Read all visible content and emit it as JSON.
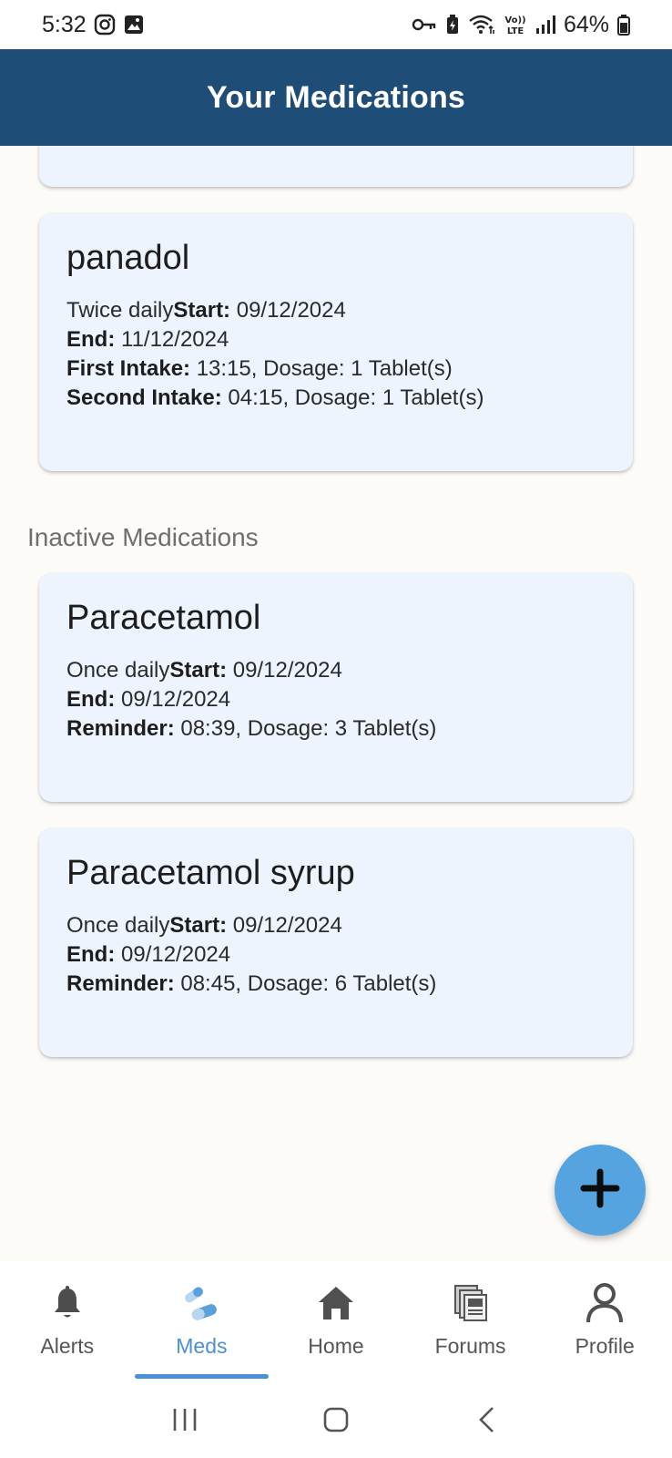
{
  "status_bar": {
    "time": "5:32",
    "battery": "64%",
    "left_icons": [
      "instagram-icon",
      "gallery-icon"
    ],
    "right_icons": [
      "vpn-key-icon",
      "battery-saver-icon",
      "wifi-icon",
      "volte-icon",
      "signal-icon",
      "battery-icon"
    ]
  },
  "app_bar": {
    "title": "Your Medications"
  },
  "active_medications": [
    {
      "name": "panadol",
      "frequency": "Twice daily",
      "start_label": "Start:",
      "start": " 09/12/2024",
      "end_label": "End:",
      "end": " 11/12/2024",
      "intakes": [
        {
          "label": "First Intake:",
          "value": " 13:15, Dosage: 1 Tablet(s)"
        },
        {
          "label": "Second Intake:",
          "value": " 04:15, Dosage: 1 Tablet(s)"
        }
      ]
    }
  ],
  "inactive_section": {
    "heading": "Inactive Medications"
  },
  "inactive_medications": [
    {
      "name": "Paracetamol",
      "frequency": "Once daily",
      "start_label": "Start:",
      "start": " 09/12/2024",
      "end_label": "End:",
      "end": " 09/12/2024",
      "intakes": [
        {
          "label": "Reminder:",
          "value": " 08:39, Dosage: 3 Tablet(s)"
        }
      ]
    },
    {
      "name": "Paracetamol syrup",
      "frequency": "Once daily",
      "start_label": "Start:",
      "start": " 09/12/2024",
      "end_label": "End:",
      "end": " 09/12/2024",
      "intakes": [
        {
          "label": "Reminder:",
          "value": " 08:45, Dosage: 6 Tablet(s)"
        }
      ]
    }
  ],
  "fab": {
    "icon": "plus-icon"
  },
  "bottom_nav": {
    "items": [
      {
        "label": "Alerts",
        "icon": "bell-icon"
      },
      {
        "label": "Meds",
        "icon": "pills-icon",
        "active": true
      },
      {
        "label": "Home",
        "icon": "home-icon"
      },
      {
        "label": "Forums",
        "icon": "forums-icon"
      },
      {
        "label": "Profile",
        "icon": "person-icon"
      }
    ]
  },
  "system_nav": {
    "buttons": [
      "recents-icon",
      "home-circle-icon",
      "back-icon"
    ]
  },
  "colors": {
    "app_bar": "#1e4d78",
    "card_bg": "#edf4fd",
    "fab": "#55a4df",
    "active_nav": "#4a90d9",
    "page_bg": "#fcfbf8"
  }
}
